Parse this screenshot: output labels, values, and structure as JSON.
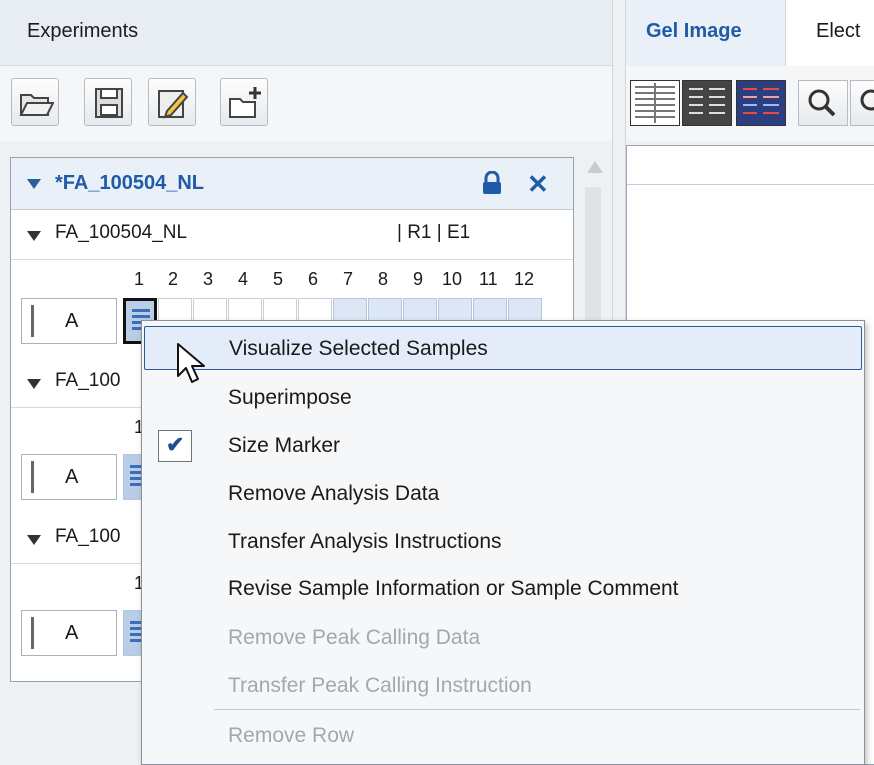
{
  "left_panel": {
    "header": "Experiments",
    "toolbar": [
      "open-folder-icon",
      "save-icon",
      "edit-icon",
      "new-experiment-icon"
    ]
  },
  "experiment": {
    "title": "*FA_100504_NL",
    "runs": [
      {
        "name": "FA_100504_NL",
        "meta": "| R1 | E1",
        "columns": [
          "1",
          "2",
          "3",
          "4",
          "5",
          "6",
          "7",
          "8",
          "9",
          "10",
          "11",
          "12"
        ],
        "row_label": "A"
      },
      {
        "name": "FA_100",
        "column_first": "1",
        "row_label": "A"
      },
      {
        "name": "FA_100",
        "column_first": "1",
        "row_label": "A"
      }
    ]
  },
  "right_panel": {
    "tabs": [
      {
        "label": "Gel Image",
        "active": true
      },
      {
        "label": "Elect",
        "active": false
      }
    ],
    "toolbar": [
      "view-grid-icon",
      "view-dark-icon",
      "view-color-icon",
      "zoom-icon"
    ]
  },
  "context_menu": {
    "items": [
      {
        "label": "Visualize Selected Samples",
        "enabled": true,
        "highlighted": true
      },
      {
        "label": "Superimpose",
        "enabled": true
      },
      {
        "label": "Size Marker",
        "enabled": true,
        "checked": true
      },
      {
        "label": "Remove Analysis Data",
        "enabled": true
      },
      {
        "label": "Transfer Analysis Instructions",
        "enabled": true
      },
      {
        "label": "Revise Sample Information or Sample Comment",
        "enabled": true
      },
      {
        "label": "Remove Peak Calling Data",
        "enabled": false
      },
      {
        "label": "Transfer Peak Calling Instruction",
        "enabled": false
      },
      {
        "label": "Remove Row",
        "enabled": false
      }
    ]
  },
  "colors": {
    "accent": "#1f5ba8",
    "highlight": "#e3ecf8",
    "disabled": "#a3a8ae"
  }
}
